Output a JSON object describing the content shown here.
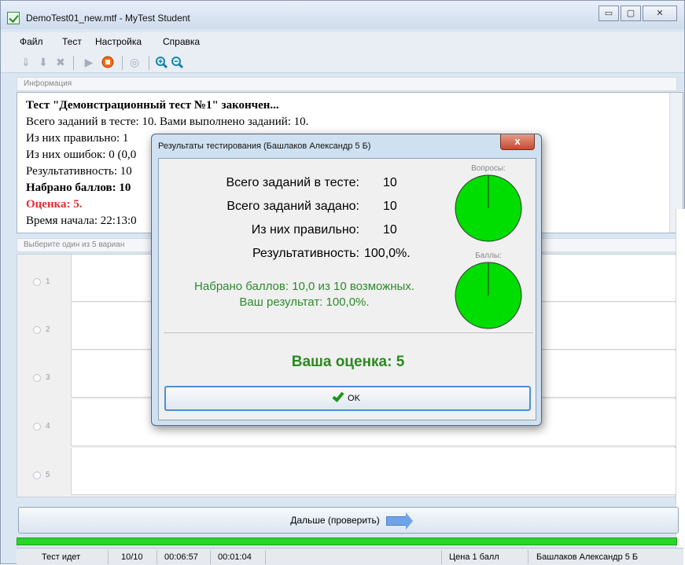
{
  "window": {
    "title": "DemoTest01_new.mtf - MyTest Student",
    "min": "▭",
    "max": "▢",
    "close": "✕"
  },
  "menu": [
    "Файл",
    "Тест",
    "Настройка",
    "Справка"
  ],
  "toolbar": [
    "download-icon",
    "down-arrow-icon",
    "delete-icon",
    "play-icon",
    "stop-icon",
    "pause-icon",
    "zoom-in-icon",
    "zoom-out-icon"
  ],
  "info": {
    "header": "Информация",
    "lines": [
      "Тест \"Демонстрационный тест №1\" закончен...",
      "Всего заданий в тесте: 10. Вами выполнено заданий: 10.",
      "Из них правильно: 1",
      "Из них ошибок: 0 (0,0",
      "Результативность: 10",
      "Набрано баллов: 10",
      "Оценка: 5.",
      "Время начала: 22:13:0"
    ]
  },
  "options": {
    "header": "Выберите один из 5 вариан",
    "items": [
      "1",
      "2",
      "3",
      "4",
      "5"
    ]
  },
  "next_button": "Дальше (проверить)",
  "progress": 1.0,
  "status": {
    "state": "Тест идет",
    "count": "10/10",
    "elapsed": "00:06:57",
    "remaining": "00:01:04",
    "price": "Цена 1 балл",
    "user": "Башлаков Александр 5 Б"
  },
  "dialog": {
    "title": "Результаты тестирования (Башлаков Александр 5 Б)",
    "close": "x",
    "stats": [
      {
        "label": "Всего заданий в тесте:",
        "value": "10"
      },
      {
        "label": "Всего заданий задано:",
        "value": "10"
      },
      {
        "label": "Из них правильно:",
        "value": "10"
      },
      {
        "label": "Результативность:",
        "value": "100,0%."
      }
    ],
    "pie1": {
      "label": "Вопросы:",
      "fraction": 1.0,
      "color": "#00dd00"
    },
    "pie2": {
      "label": "Баллы:",
      "fraction": 1.0,
      "color": "#00dd00"
    },
    "score_line": "Набрано баллов: 10,0 из 10 возможных.",
    "result_line": "Ваш результат: 100,0%.",
    "grade": "Ваша оценка: 5",
    "ok": "OK"
  }
}
